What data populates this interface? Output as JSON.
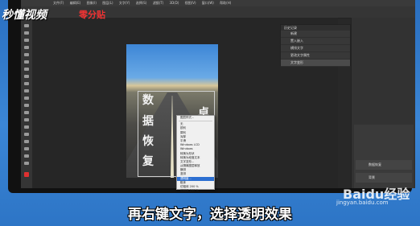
{
  "watermark": {
    "brand": "秒懂视频",
    "brand2": "零分贴",
    "baidu": "Baidu经验",
    "url": "jingyan.baidu.com"
  },
  "menubar": [
    "文件(F)",
    "编辑(E)",
    "图像(I)",
    "图层(L)",
    "文字(Y)",
    "选择(S)",
    "滤镜(T)",
    "3D(D)",
    "视图(V)",
    "窗口(W)",
    "帮助(H)"
  ],
  "canvas_text": [
    "数",
    "据",
    "恢",
    "复"
  ],
  "canvas_text2": "卓",
  "history": {
    "title": "历史记录",
    "items": [
      "新建",
      "置入嵌入",
      "横排文字",
      "更改文字属性",
      "文字变形"
    ]
  },
  "context_menu": [
    "图层样式...",
    "无",
    "锐利",
    "犀利",
    "浑厚",
    "平滑",
    "Windows LCD",
    "Windows",
    "转换为形状",
    "转换为段落文本",
    "文字变形...",
    "从隔离图层释放",
    "横排",
    "竖排",
    "透明度...",
    "粗体",
    "仿粗体 200 %",
    "仿斜体 200 %"
  ],
  "context_menu_selected": 14,
  "layers": [
    {
      "name": "数据恢复"
    },
    {
      "name": "背景"
    }
  ],
  "caption": "再右键文字，选择透明效果"
}
